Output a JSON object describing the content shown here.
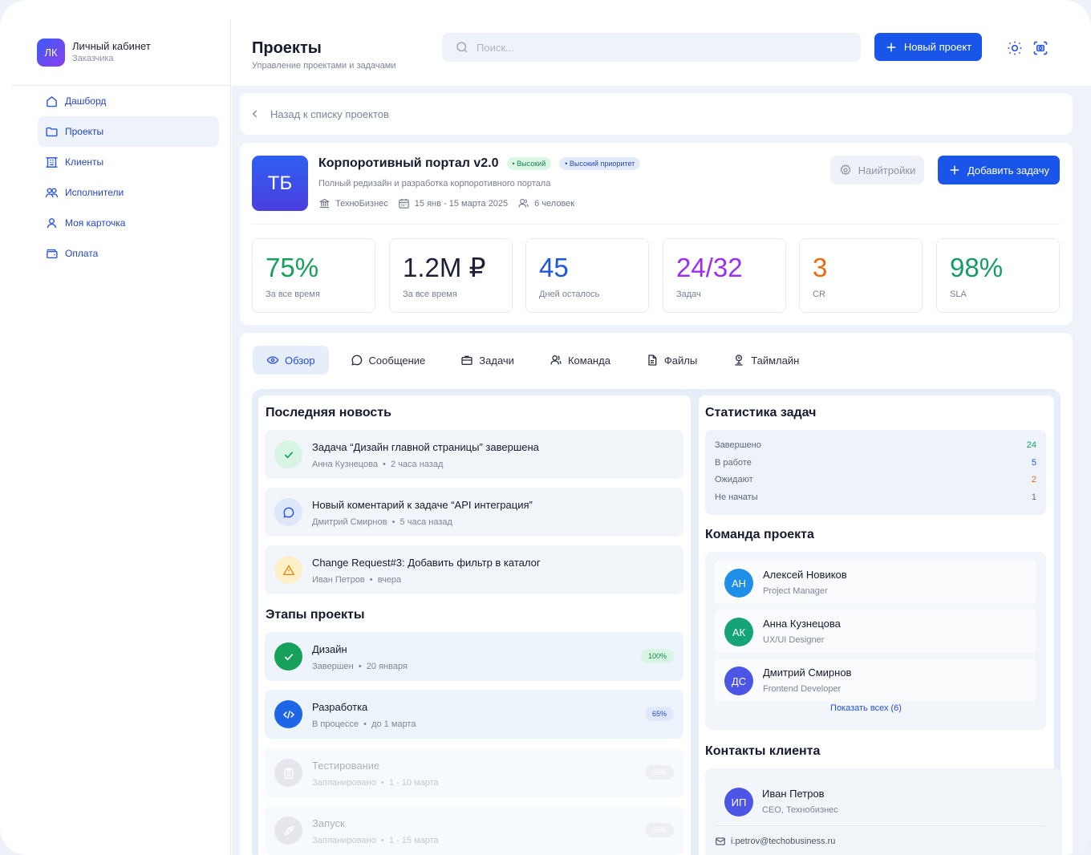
{
  "brand": {
    "initials": "ЛК",
    "title": "Личный кабинет",
    "subtitle": "Заказчика"
  },
  "nav": [
    {
      "label": "Дашборд",
      "icon": "home-icon"
    },
    {
      "label": "Проекты",
      "icon": "folder-icon",
      "active": true
    },
    {
      "label": "Клиенты",
      "icon": "building-icon"
    },
    {
      "label": "Исполнители",
      "icon": "users-icon"
    },
    {
      "label": "Моя карточка",
      "icon": "user-icon"
    },
    {
      "label": "Оплата",
      "icon": "wallet-icon"
    }
  ],
  "header": {
    "title": "Проекты",
    "subtitle": "Управление проектами и задачами",
    "search_placeholder": "Поиск...",
    "new_project": "Новый проект"
  },
  "back": {
    "label": "Назад к списку проектов"
  },
  "project": {
    "initials": "ТБ",
    "name": "Корпоротивный портал v2.0",
    "badge1": "• Высокий",
    "badge2": "• Высокий приоритет",
    "description": "Полный редизайн и разработка корпоротивного портала",
    "client": "ТехноБизнес",
    "dates": "15 янв - 15 марта 2025",
    "people": "6 человек",
    "settings_label": "Наийтройки",
    "add_task_label": "Добавить задачу"
  },
  "stats": [
    {
      "value": "75%",
      "label": "За все время",
      "color": "#16a05a"
    },
    {
      "value": "1.2M ₽",
      "label": "За все время",
      "color": "#1b2036"
    },
    {
      "value": "45",
      "label": "Дней осталось",
      "color": "#1f56e0"
    },
    {
      "value": "24/32",
      "label": "Задач",
      "color": "#9b2ef0"
    },
    {
      "value": "3",
      "label": "CR",
      "color": "#ea6a10"
    },
    {
      "value": "98%",
      "label": "SLA",
      "color": "#159b63"
    }
  ],
  "tabs": [
    {
      "label": "Обзор",
      "icon": "eye-icon",
      "active": true
    },
    {
      "label": "Сообщение",
      "icon": "message-icon"
    },
    {
      "label": "Задачи",
      "icon": "briefcase-icon"
    },
    {
      "label": "Команда",
      "icon": "team-icon"
    },
    {
      "label": "Файлы",
      "icon": "file-icon"
    },
    {
      "label": "Таймлайн",
      "icon": "timeline-icon"
    }
  ],
  "news": {
    "title": "Последняя новость",
    "items": [
      {
        "title": "Задача “Дизайн главной страницы” завершена",
        "author": "Анна Кузнецова",
        "time": "2 часа назад",
        "icon": "check-icon"
      },
      {
        "title": "Новый коментарий к задаче “API интеграция”",
        "author": "Дмитрий Смирнов",
        "time": "5 часа назад",
        "icon": "comment-icon"
      },
      {
        "title": "Change Request#3: Добавить фильтр в каталог",
        "author": "Иван Петров",
        "time": "вчера",
        "icon": "warning-icon"
      }
    ]
  },
  "stages": {
    "title": "Этапы проекты",
    "items": [
      {
        "name": "Дизайн",
        "status": "Завершен",
        "date": "20 января",
        "pct": "100%",
        "icon": "check-icon"
      },
      {
        "name": "Разработка",
        "status": "В процессе",
        "date": "до 1 марта",
        "pct": "65%",
        "icon": "code-icon"
      },
      {
        "name": "Тестирование",
        "status": "Запланировано",
        "date": "1 - 10 марта",
        "pct": "65%",
        "icon": "clipboard-icon"
      },
      {
        "name": "Запуск",
        "status": "Запланировано",
        "date": "1 - 15 марта",
        "pct": "65%",
        "icon": "rocket-icon"
      }
    ]
  },
  "task_stats": {
    "title": "Статистика задач",
    "rows": [
      {
        "label": "Завершено",
        "value": "24",
        "color": "#16a05a"
      },
      {
        "label": "В работе",
        "value": "5",
        "color": "#1f56e0"
      },
      {
        "label": "Ожидают",
        "value": "2",
        "color": "#ea6a10"
      },
      {
        "label": "Не начаты",
        "value": "1",
        "color": "#5f6679"
      }
    ]
  },
  "team": {
    "title": "Команда проекта",
    "members": [
      {
        "initials": "АН",
        "name": "Алексей Новиков",
        "role": "Project Manager",
        "color": "#1f8ee8"
      },
      {
        "initials": "АК",
        "name": "Анна Кузнецова",
        "role": "UX/UI Designer",
        "color": "#15a37a"
      },
      {
        "initials": "ДС",
        "name": "Дмитрий Смирнов",
        "role": "Frontend Developer",
        "color": "#4c55e6"
      }
    ],
    "show_all": "Показать всех (6)"
  },
  "contacts": {
    "title": "Контакты клиента",
    "initials": "ИП",
    "name": "Иван Петров",
    "role": "CEO, Технобизнес",
    "email": "i.petrov@techobusiness.ru"
  }
}
